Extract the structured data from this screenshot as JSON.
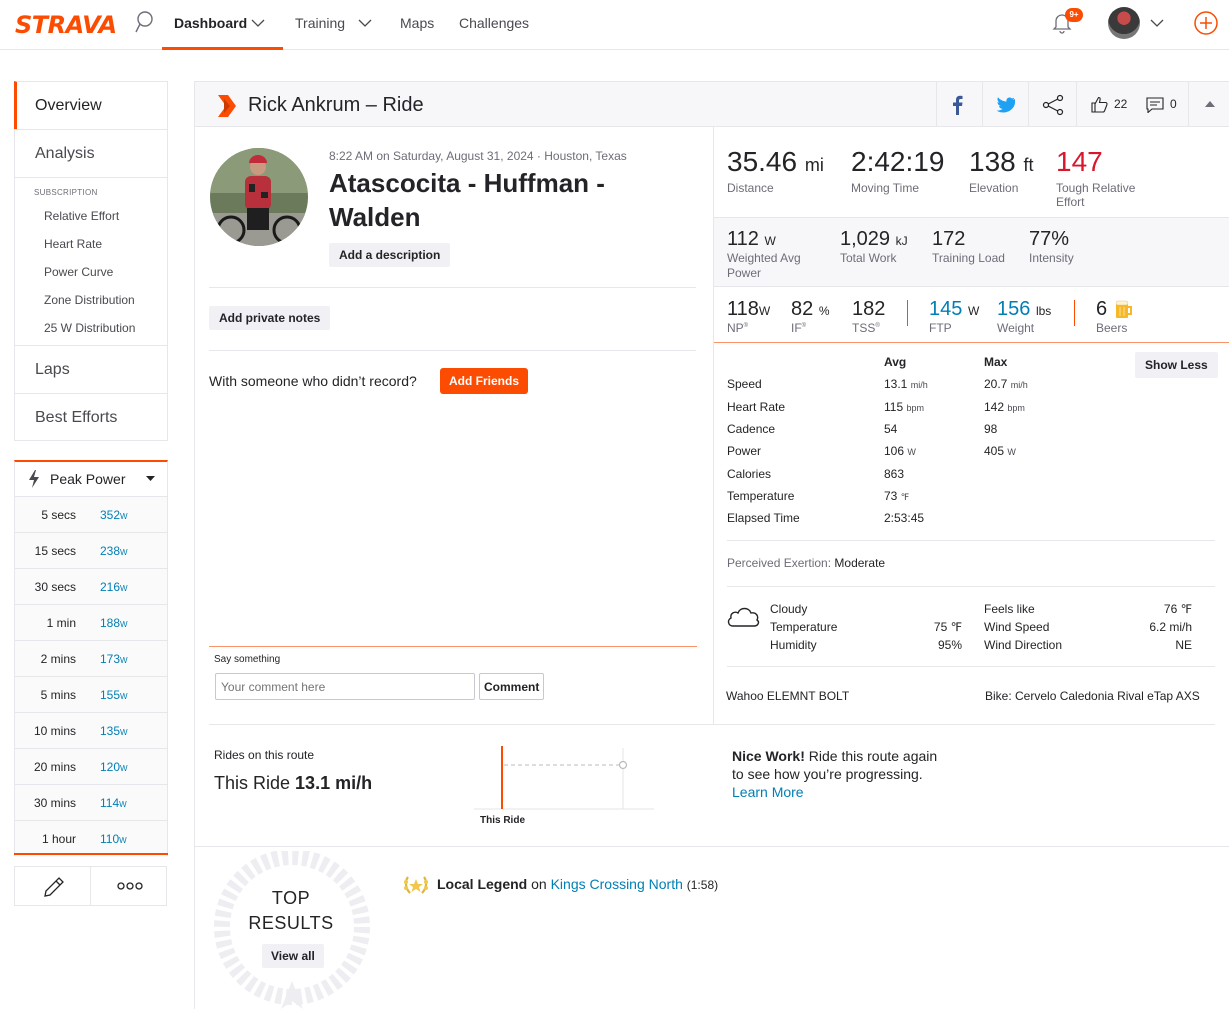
{
  "nav": {
    "logo": "STRAVA",
    "dashboard": "Dashboard",
    "training": "Training",
    "maps": "Maps",
    "challenges": "Challenges",
    "notif_badge": "9+"
  },
  "sidebar": {
    "overview": "Overview",
    "analysis": "Analysis",
    "subscription_heading": "SUBSCRIPTION",
    "sub_items": [
      "Relative Effort",
      "Heart Rate",
      "Power Curve",
      "Zone Distribution",
      "25 W Distribution"
    ],
    "laps": "Laps",
    "best_efforts": "Best Efforts",
    "peak_power": "Peak Power",
    "power_unit": "W",
    "peak_rows": [
      {
        "dur": "5 secs",
        "val": "352"
      },
      {
        "dur": "15 secs",
        "val": "238"
      },
      {
        "dur": "30 secs",
        "val": "216"
      },
      {
        "dur": "1 min",
        "val": "188"
      },
      {
        "dur": "2 mins",
        "val": "173"
      },
      {
        "dur": "5 mins",
        "val": "155"
      },
      {
        "dur": "10 mins",
        "val": "135"
      },
      {
        "dur": "20 mins",
        "val": "120"
      },
      {
        "dur": "30 mins",
        "val": "114"
      },
      {
        "dur": "1 hour",
        "val": "110"
      }
    ]
  },
  "header": {
    "title": "Rick Ankrum – Ride",
    "kudos": "22",
    "comments": "0"
  },
  "activity": {
    "datetime": "8:22 AM on Saturday, August 31, 2024 · Houston, Texas",
    "title_line1": "Atascocita - Huffman -",
    "title_line2": "Walden",
    "add_description": "Add a description",
    "add_private_notes": "Add private notes",
    "with_someone": "With someone who didn’t record?",
    "add_friends": "Add Friends",
    "say_something": "Say something",
    "comment_placeholder": "Your comment here",
    "comment_button": "Comment"
  },
  "stats": {
    "distance": {
      "value": "35.46",
      "unit": "mi",
      "label": "Distance"
    },
    "moving_time": {
      "value": "2:42:19",
      "label": "Moving Time"
    },
    "elevation": {
      "value": "138",
      "unit": "ft",
      "label": "Elevation"
    },
    "relative_effort": {
      "value": "147",
      "label1": "Tough Relative",
      "label2": "Effort"
    },
    "weighted_power": {
      "value": "112",
      "unit": "W",
      "label1": "Weighted Avg",
      "label2": "Power"
    },
    "total_work": {
      "value": "1,029",
      "unit": "kJ",
      "label": "Total Work"
    },
    "training_load": {
      "value": "172",
      "label": "Training Load"
    },
    "intensity": {
      "value": "77%",
      "label": "Intensity"
    },
    "np": {
      "value": "118",
      "unit": "W",
      "label": "NP"
    },
    "if": {
      "value": "82",
      "unit": "%",
      "label": "IF"
    },
    "tss": {
      "value": "182",
      "label": "TSS"
    },
    "ftp": {
      "value": "145",
      "unit": "W",
      "label": "FTP"
    },
    "weight": {
      "value": "156",
      "unit": "lbs",
      "label": "Weight"
    },
    "beers": {
      "value": "6",
      "label": "Beers"
    },
    "reg": "®"
  },
  "table": {
    "avg_h": "Avg",
    "max_h": "Max",
    "show_less": "Show Less",
    "rows": [
      {
        "label": "Speed",
        "avg": "13.1",
        "avg_u": "mi/h",
        "max": "20.7",
        "max_u": "mi/h"
      },
      {
        "label": "Heart Rate",
        "avg": "115",
        "avg_u": "bpm",
        "max": "142",
        "max_u": "bpm"
      },
      {
        "label": "Cadence",
        "avg": "54",
        "avg_u": "",
        "max": "98",
        "max_u": ""
      },
      {
        "label": "Power",
        "avg": "106",
        "avg_u": "W",
        "max": "405",
        "max_u": "W"
      },
      {
        "label": "Calories",
        "avg": "863",
        "avg_u": "",
        "max": "",
        "max_u": ""
      },
      {
        "label": "Temperature",
        "avg": "73",
        "avg_u": "℉",
        "max": "",
        "max_u": ""
      },
      {
        "label": "Elapsed Time",
        "avg": "2:53:45",
        "avg_u": "",
        "max": "",
        "max_u": ""
      }
    ],
    "perceived_label": "Perceived Exertion:",
    "perceived_value": "Moderate"
  },
  "weather": {
    "condition": "Cloudy",
    "temp_label": "Temperature",
    "temp": "75 ℉",
    "humidity_label": "Humidity",
    "humidity": "95%",
    "feels_label": "Feels like",
    "feels": "76 ℉",
    "wind_speed_label": "Wind Speed",
    "wind_speed": "6.2 mi/h",
    "wind_dir_label": "Wind Direction",
    "wind_dir": "NE"
  },
  "device": "Wahoo ELEMNT BOLT",
  "bike": "Bike: Cervelo Caledonia Rival eTap AXS",
  "route": {
    "heading": "Rides on this route",
    "this_ride": "This Ride",
    "speed": "13.1 mi/h",
    "chart_label": "This Ride",
    "nice_work": "Nice Work!",
    "nice_text1": "Ride this route again",
    "nice_text2": "to see how you’re progressing.",
    "learn_more": "Learn More"
  },
  "results": {
    "top": "TOP",
    "results": "RESULTS",
    "view_all": "View all",
    "legend": "Local Legend",
    "on": "on",
    "segment": "Kings Crossing North",
    "time": "(1:58)"
  },
  "colors": {
    "brand": "#fc4c02",
    "link": "#007fb6",
    "effort": "#d8172d"
  }
}
